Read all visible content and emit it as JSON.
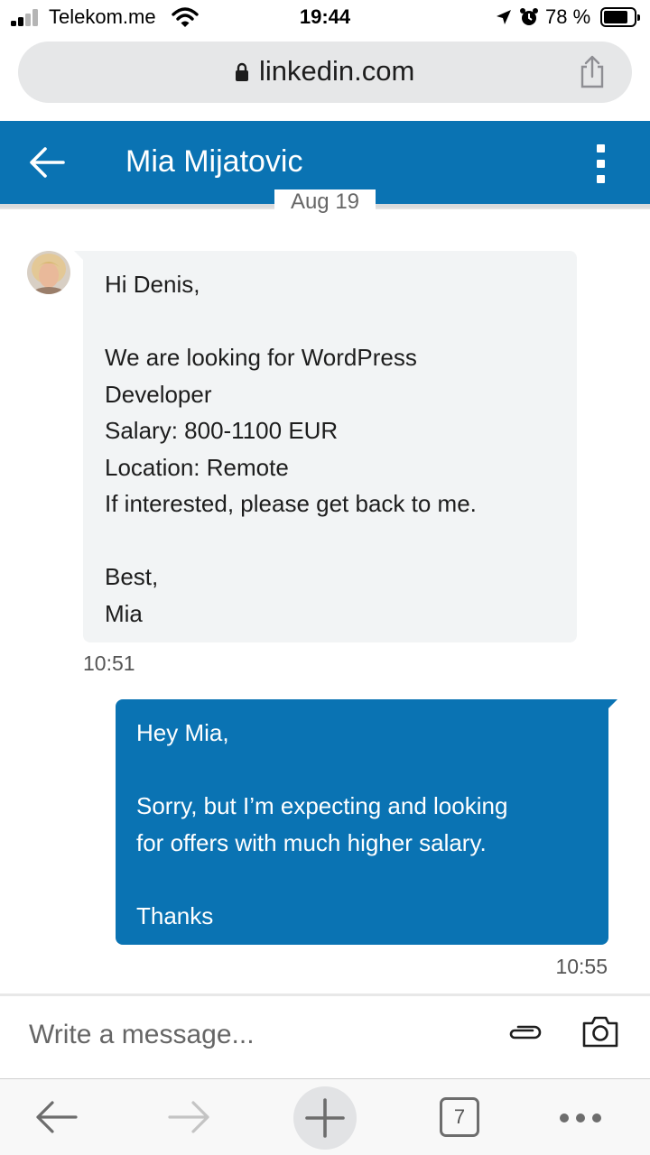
{
  "status_bar": {
    "carrier": "Telekom.me",
    "time": "19:44",
    "battery": "78 %",
    "battery_level": 0.78
  },
  "address_bar": {
    "domain": "linkedin.com"
  },
  "header": {
    "contact_name": "Mia Mijatovic"
  },
  "conversation": {
    "date_label": "Aug 19",
    "messages": [
      {
        "sender": "incoming",
        "text": "Hi Denis,\n\nWe are looking for WordPress\nDeveloper\nSalary: 800-1100 EUR\nLocation: Remote\nIf interested, please get back to me.\n\nBest,\nMia",
        "time": "10:51"
      },
      {
        "sender": "outgoing",
        "text": "Hey Mia,\n\nSorry, but I’m expecting and looking\nfor offers with much higher salary.\n\nThanks",
        "time": "10:55"
      }
    ]
  },
  "composer": {
    "placeholder": "Write a message..."
  },
  "browser_toolbar": {
    "tab_count": "7"
  },
  "colors": {
    "brand_blue": "#0a73b3",
    "incoming_bubble": "#f2f4f5"
  },
  "icons": [
    "signal-icon",
    "wifi-icon",
    "location-arrow-icon",
    "alarm-icon",
    "battery-icon",
    "lock-icon",
    "share-icon",
    "back-arrow-icon",
    "more-vertical-icon",
    "paperclip-icon",
    "camera-icon",
    "browser-back-icon",
    "browser-forward-icon",
    "plus-icon",
    "tabs-icon",
    "more-horizontal-icon"
  ]
}
